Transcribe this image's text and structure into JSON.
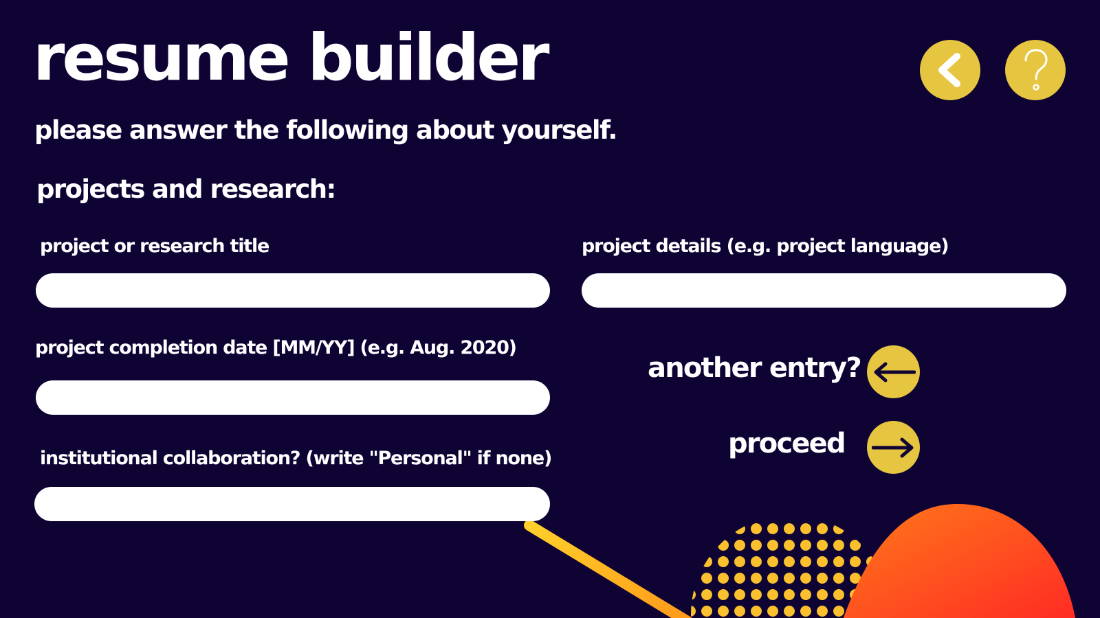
{
  "header": {
    "title": "resume builder",
    "subtitle": "please answer the following about yourself."
  },
  "section_title": "projects and research:",
  "fields": {
    "project_title": {
      "label": "project or research title",
      "value": ""
    },
    "project_details": {
      "label": "project details (e.g. project language)",
      "value": ""
    },
    "completion_date": {
      "label": "project completion date [MM/YY]  (e.g. Aug. 2020)",
      "value": ""
    },
    "collaboration": {
      "label": "institutional collaboration? (write \"Personal\" if none)",
      "value": ""
    }
  },
  "actions": {
    "another_entry_label": "another entry?",
    "proceed_label": "proceed"
  },
  "icons": {
    "back": "chevron-left-icon",
    "help": "question-mark-icon",
    "another_entry": "arrow-left-icon",
    "proceed": "arrow-right-icon"
  },
  "colors": {
    "background": "#0f0334",
    "accent_yellow": "#e6c540",
    "field_bg": "#ffffff",
    "text": "#ffffff",
    "blob_orange": "#ff5a1f",
    "blob_red": "#ff2c20",
    "dots": "#fbc02d"
  }
}
